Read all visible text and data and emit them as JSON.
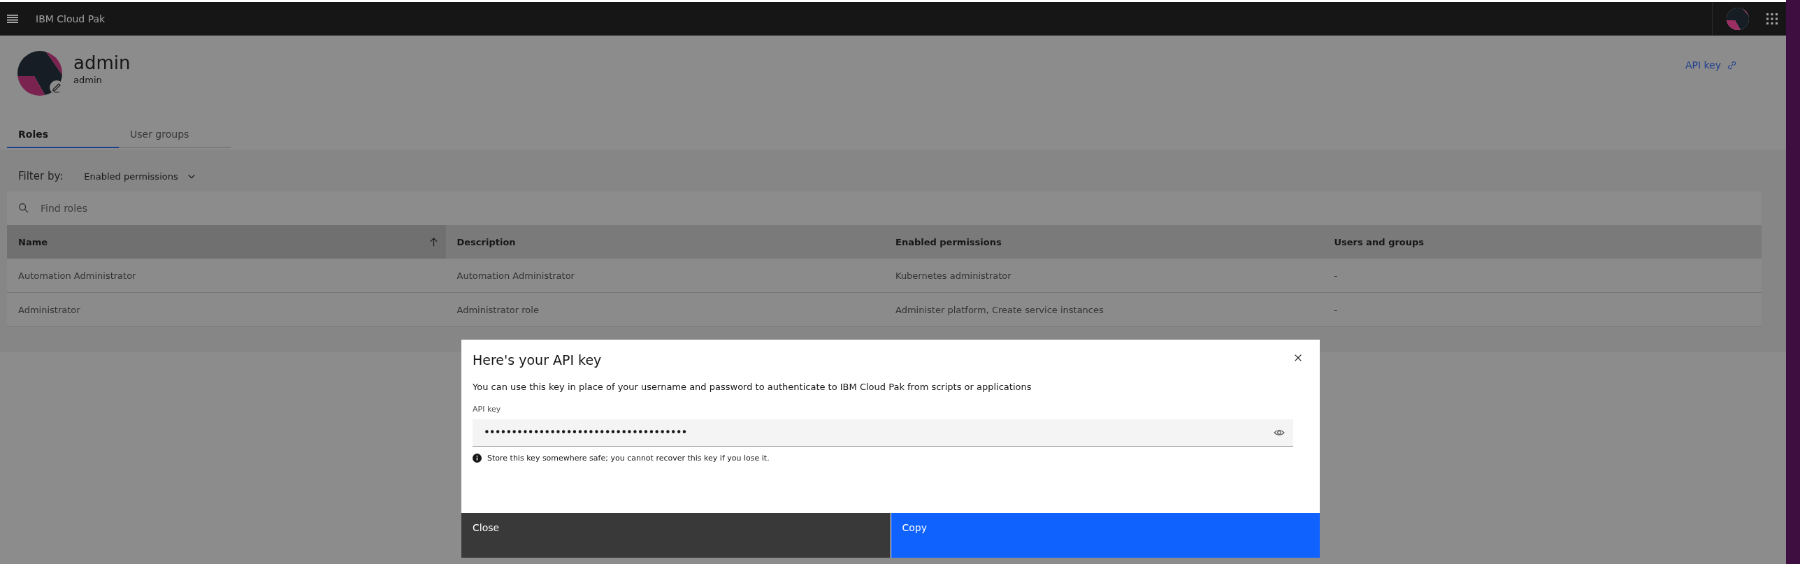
{
  "header": {
    "title": "IBM Cloud Pak"
  },
  "profile": {
    "name": "admin",
    "username": "admin"
  },
  "api_key_link": "API key",
  "tabs": [
    {
      "label": "Roles",
      "selected": true
    },
    {
      "label": "User groups",
      "selected": false
    }
  ],
  "filter": {
    "label": "Filter by:",
    "value": "Enabled permissions"
  },
  "search": {
    "placeholder": "Find roles"
  },
  "table": {
    "columns": [
      {
        "label": "Name",
        "sorted": true
      },
      {
        "label": "Description",
        "sorted": false
      },
      {
        "label": "Enabled permissions",
        "sorted": false
      },
      {
        "label": "Users and groups",
        "sorted": false
      }
    ],
    "rows": [
      [
        "Automation Administrator",
        "Automation Administrator",
        "Kubernetes administrator",
        "-"
      ],
      [
        "Administrator",
        "Administrator role",
        "Administer platform, Create service instances",
        "-"
      ]
    ]
  },
  "dialog": {
    "title": "Here's your API key",
    "text": "You can use this key in place of your username and password to authenticate to IBM Cloud Pak from scripts or applications",
    "field_label": "API key",
    "field_value": "•••••••••••••••••••••••••••••••••••••",
    "hint": "Store this key somewhere safe; you cannot recover this key if you lose it.",
    "buttons": [
      {
        "label": "Close",
        "kind": "secondary"
      },
      {
        "label": "Copy",
        "kind": "primary"
      }
    ]
  }
}
